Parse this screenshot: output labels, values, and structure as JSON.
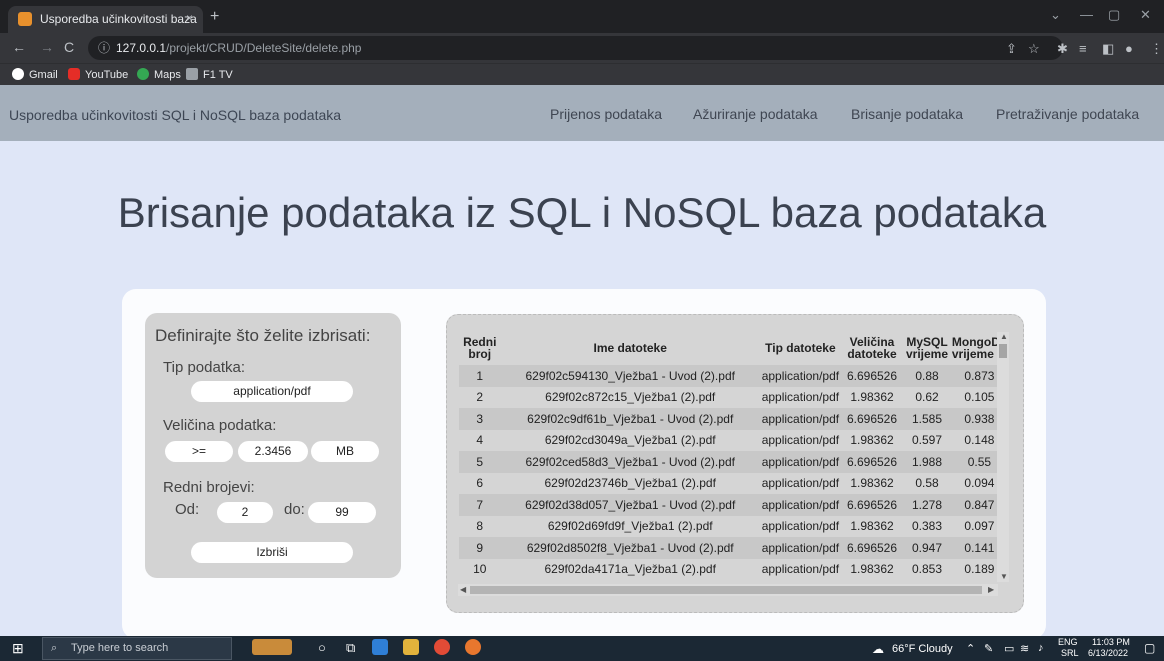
{
  "browser": {
    "tab_title": "Usporedba učinkovitosti baza",
    "tab_close": "×",
    "new_tab": "+",
    "url_host": "127.0.0.1",
    "url_path": "/projekt/CRUD/DeleteSite/delete.php",
    "bookmarks": [
      "Gmail",
      "YouTube",
      "Maps",
      "F1 TV"
    ]
  },
  "nav": {
    "brand": "Usporedba učinkovitosti SQL i NoSQL baza podataka",
    "links": [
      "Prijenos podataka",
      "Ažuriranje podataka",
      "Brisanje podataka",
      "Pretraživanje podataka"
    ]
  },
  "page": {
    "heading": "Brisanje podataka iz SQL i NoSQL baza podataka"
  },
  "form": {
    "title": "Definirajte što želite izbrisati:",
    "type_label": "Tip podatka:",
    "type_value": "application/pdf",
    "size_label": "Veličina podatka:",
    "size_operator": ">=",
    "size_value": "2.3456",
    "size_unit": "MB",
    "range_label": "Redni brojevi:",
    "from_label": "Od:",
    "from_value": "2",
    "to_label": "do:",
    "to_value": "99",
    "submit": "Izbriši"
  },
  "table": {
    "headers": [
      "Redni broj",
      "Ime datoteke",
      "Tip datoteke",
      "Veličina datoteke",
      "MySQL vrijeme",
      "MongoD vrijeme"
    ],
    "rows": [
      [
        "1",
        "629f02c594130_Vježba1 - Uvod (2).pdf",
        "application/pdf",
        "6.696526",
        "0.88",
        "0.873"
      ],
      [
        "2",
        "629f02c872c15_Vježba1 (2).pdf",
        "application/pdf",
        "1.98362",
        "0.62",
        "0.105"
      ],
      [
        "3",
        "629f02c9df61b_Vježba1 - Uvod (2).pdf",
        "application/pdf",
        "6.696526",
        "1.585",
        "0.938"
      ],
      [
        "4",
        "629f02cd3049a_Vježba1 (2).pdf",
        "application/pdf",
        "1.98362",
        "0.597",
        "0.148"
      ],
      [
        "5",
        "629f02ced58d3_Vježba1 - Uvod (2).pdf",
        "application/pdf",
        "6.696526",
        "1.988",
        "0.55"
      ],
      [
        "6",
        "629f02d23746b_Vježba1 (2).pdf",
        "application/pdf",
        "1.98362",
        "0.58",
        "0.094"
      ],
      [
        "7",
        "629f02d38d057_Vježba1 - Uvod (2).pdf",
        "application/pdf",
        "6.696526",
        "1.278",
        "0.847"
      ],
      [
        "8",
        "629f02d69fd9f_Vježba1 (2).pdf",
        "application/pdf",
        "1.98362",
        "0.383",
        "0.097"
      ],
      [
        "9",
        "629f02d8502f8_Vježba1 - Uvod (2).pdf",
        "application/pdf",
        "6.696526",
        "0.947",
        "0.141"
      ],
      [
        "10",
        "629f02da4171a_Vježba1 (2).pdf",
        "application/pdf",
        "1.98362",
        "0.853",
        "0.189"
      ]
    ]
  },
  "taskbar": {
    "search_placeholder": "Type here to search",
    "weather": "66°F Cloudy",
    "lang_1": "ENG",
    "lang_2": "SRL",
    "time": "11:03 PM",
    "date": "6/13/2022"
  }
}
